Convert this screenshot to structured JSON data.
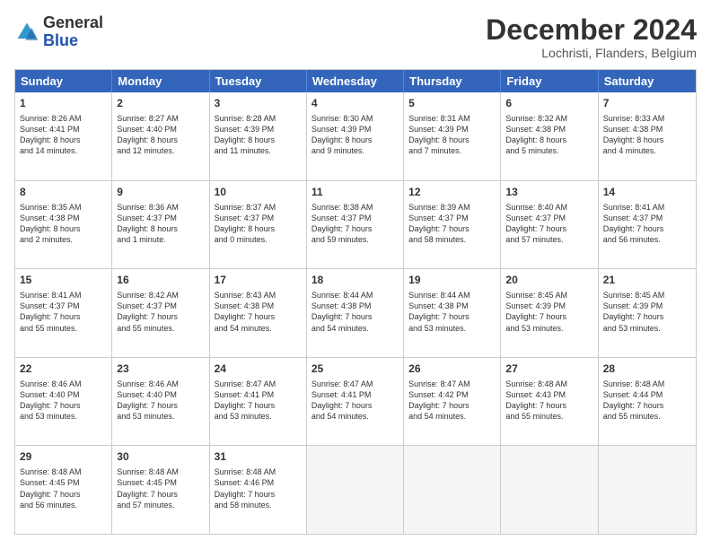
{
  "header": {
    "logo_general": "General",
    "logo_blue": "Blue",
    "month_title": "December 2024",
    "location": "Lochristi, Flanders, Belgium"
  },
  "calendar": {
    "days": [
      "Sunday",
      "Monday",
      "Tuesday",
      "Wednesday",
      "Thursday",
      "Friday",
      "Saturday"
    ],
    "rows": [
      [
        {
          "day": "1",
          "info": "Sunrise: 8:26 AM\nSunset: 4:41 PM\nDaylight: 8 hours\nand 14 minutes."
        },
        {
          "day": "2",
          "info": "Sunrise: 8:27 AM\nSunset: 4:40 PM\nDaylight: 8 hours\nand 12 minutes."
        },
        {
          "day": "3",
          "info": "Sunrise: 8:28 AM\nSunset: 4:39 PM\nDaylight: 8 hours\nand 11 minutes."
        },
        {
          "day": "4",
          "info": "Sunrise: 8:30 AM\nSunset: 4:39 PM\nDaylight: 8 hours\nand 9 minutes."
        },
        {
          "day": "5",
          "info": "Sunrise: 8:31 AM\nSunset: 4:39 PM\nDaylight: 8 hours\nand 7 minutes."
        },
        {
          "day": "6",
          "info": "Sunrise: 8:32 AM\nSunset: 4:38 PM\nDaylight: 8 hours\nand 5 minutes."
        },
        {
          "day": "7",
          "info": "Sunrise: 8:33 AM\nSunset: 4:38 PM\nDaylight: 8 hours\nand 4 minutes."
        }
      ],
      [
        {
          "day": "8",
          "info": "Sunrise: 8:35 AM\nSunset: 4:38 PM\nDaylight: 8 hours\nand 2 minutes."
        },
        {
          "day": "9",
          "info": "Sunrise: 8:36 AM\nSunset: 4:37 PM\nDaylight: 8 hours\nand 1 minute."
        },
        {
          "day": "10",
          "info": "Sunrise: 8:37 AM\nSunset: 4:37 PM\nDaylight: 8 hours\nand 0 minutes."
        },
        {
          "day": "11",
          "info": "Sunrise: 8:38 AM\nSunset: 4:37 PM\nDaylight: 7 hours\nand 59 minutes."
        },
        {
          "day": "12",
          "info": "Sunrise: 8:39 AM\nSunset: 4:37 PM\nDaylight: 7 hours\nand 58 minutes."
        },
        {
          "day": "13",
          "info": "Sunrise: 8:40 AM\nSunset: 4:37 PM\nDaylight: 7 hours\nand 57 minutes."
        },
        {
          "day": "14",
          "info": "Sunrise: 8:41 AM\nSunset: 4:37 PM\nDaylight: 7 hours\nand 56 minutes."
        }
      ],
      [
        {
          "day": "15",
          "info": "Sunrise: 8:41 AM\nSunset: 4:37 PM\nDaylight: 7 hours\nand 55 minutes."
        },
        {
          "day": "16",
          "info": "Sunrise: 8:42 AM\nSunset: 4:37 PM\nDaylight: 7 hours\nand 55 minutes."
        },
        {
          "day": "17",
          "info": "Sunrise: 8:43 AM\nSunset: 4:38 PM\nDaylight: 7 hours\nand 54 minutes."
        },
        {
          "day": "18",
          "info": "Sunrise: 8:44 AM\nSunset: 4:38 PM\nDaylight: 7 hours\nand 54 minutes."
        },
        {
          "day": "19",
          "info": "Sunrise: 8:44 AM\nSunset: 4:38 PM\nDaylight: 7 hours\nand 53 minutes."
        },
        {
          "day": "20",
          "info": "Sunrise: 8:45 AM\nSunset: 4:39 PM\nDaylight: 7 hours\nand 53 minutes."
        },
        {
          "day": "21",
          "info": "Sunrise: 8:45 AM\nSunset: 4:39 PM\nDaylight: 7 hours\nand 53 minutes."
        }
      ],
      [
        {
          "day": "22",
          "info": "Sunrise: 8:46 AM\nSunset: 4:40 PM\nDaylight: 7 hours\nand 53 minutes."
        },
        {
          "day": "23",
          "info": "Sunrise: 8:46 AM\nSunset: 4:40 PM\nDaylight: 7 hours\nand 53 minutes."
        },
        {
          "day": "24",
          "info": "Sunrise: 8:47 AM\nSunset: 4:41 PM\nDaylight: 7 hours\nand 53 minutes."
        },
        {
          "day": "25",
          "info": "Sunrise: 8:47 AM\nSunset: 4:41 PM\nDaylight: 7 hours\nand 54 minutes."
        },
        {
          "day": "26",
          "info": "Sunrise: 8:47 AM\nSunset: 4:42 PM\nDaylight: 7 hours\nand 54 minutes."
        },
        {
          "day": "27",
          "info": "Sunrise: 8:48 AM\nSunset: 4:43 PM\nDaylight: 7 hours\nand 55 minutes."
        },
        {
          "day": "28",
          "info": "Sunrise: 8:48 AM\nSunset: 4:44 PM\nDaylight: 7 hours\nand 55 minutes."
        }
      ],
      [
        {
          "day": "29",
          "info": "Sunrise: 8:48 AM\nSunset: 4:45 PM\nDaylight: 7 hours\nand 56 minutes."
        },
        {
          "day": "30",
          "info": "Sunrise: 8:48 AM\nSunset: 4:45 PM\nDaylight: 7 hours\nand 57 minutes."
        },
        {
          "day": "31",
          "info": "Sunrise: 8:48 AM\nSunset: 4:46 PM\nDaylight: 7 hours\nand 58 minutes."
        },
        {
          "day": "",
          "info": ""
        },
        {
          "day": "",
          "info": ""
        },
        {
          "day": "",
          "info": ""
        },
        {
          "day": "",
          "info": ""
        }
      ]
    ]
  }
}
